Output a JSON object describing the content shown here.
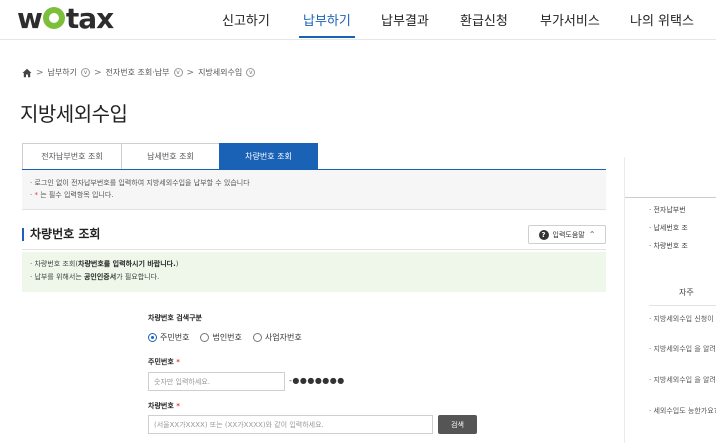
{
  "header": {
    "logo": "wetax",
    "menu": [
      {
        "label": "신고하기",
        "active": false
      },
      {
        "label": "납부하기",
        "active": true
      },
      {
        "label": "납부결과",
        "active": false
      },
      {
        "label": "환급신청",
        "active": false
      },
      {
        "label": "부가서비스",
        "active": false
      },
      {
        "label": "나의 위택스",
        "active": false
      }
    ]
  },
  "breadcrumb": {
    "items": [
      "납부하기",
      "전자번호 조회·납부",
      "지방세외수입"
    ],
    "separator": ">"
  },
  "page_title": "지방세외수입",
  "tabs": [
    {
      "label": "전자납부번호 조회",
      "active": false
    },
    {
      "label": "납세번호 조회",
      "active": false
    },
    {
      "label": "차량번호 조회",
      "active": true
    }
  ],
  "notice": {
    "line1": "· 로그인 없이 전자납부번호를 입력하여 지방세외수입을 납부할 수 있습니다",
    "line2_star": "*",
    "line2_text": "는 필수 입력항목 입니다."
  },
  "section": {
    "title": "차량번호 조회",
    "help_label": "입력도움말"
  },
  "guide": {
    "line1_pre": "· 차량번호 조회(",
    "line1_bold": "차량번호를 입력하시기 바랍니다.",
    "line1_post": ")",
    "line2_pre": "· 납부를 위해서는 ",
    "line2_bold": "공인인증서",
    "line2_post": "가 필요합니다."
  },
  "form": {
    "search_type_label": "차량번호 검색구분",
    "search_types": [
      {
        "label": "주민번호",
        "checked": true
      },
      {
        "label": "법인번호",
        "checked": false
      },
      {
        "label": "사업자번호",
        "checked": false
      }
    ],
    "resident_label": "주민번호",
    "required_mark": "*",
    "resident_placeholder": "숫자만 입력하세요.",
    "resident_masked": "-●●●●●●●",
    "vehicle_label": "차량번호",
    "vehicle_placeholder": "(서울XX가XXXX) 또는 (XX가XXXX)와 같이 입력하세요.",
    "search_button": "검색"
  },
  "aside": {
    "links": [
      "· 전자납부번",
      "· 납세번호 조",
      "· 차량번호 조"
    ],
    "faq_title": "자주",
    "faqs": [
      "· 지방세외수입 신청이 가능",
      "· 지방세외수입 을 알려주세",
      "· 지방세외수입 을 알려주세",
      "· 세외수입도 능한가요?"
    ]
  }
}
